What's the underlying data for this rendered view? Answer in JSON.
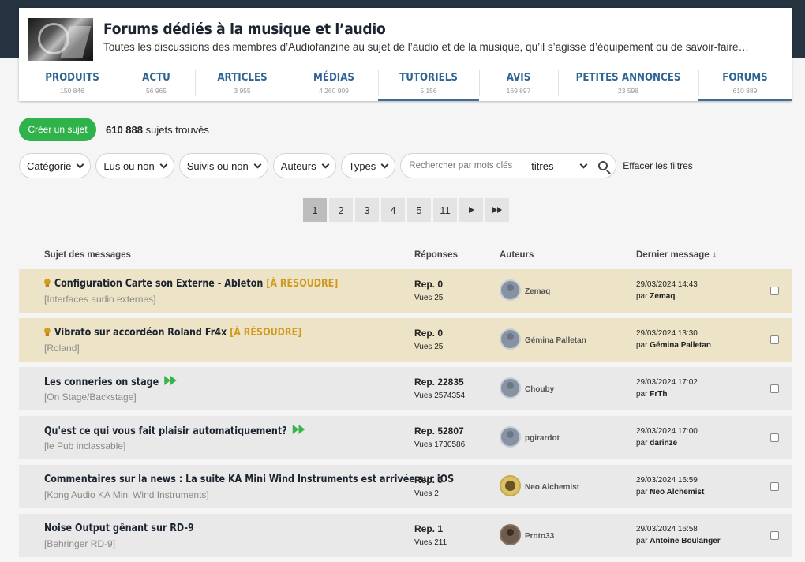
{
  "header": {
    "title": "Forums dédiés à la musique et l’audio",
    "subtitle": "Toutes les discussions des membres d’Audiofanzine au sujet de l’audio et de la musique, qu’il s’agisse d’équipement ou de savoir-faire…"
  },
  "nav": [
    {
      "label": "PRODUITS",
      "count": "150 846"
    },
    {
      "label": "ACTU",
      "count": "56 965"
    },
    {
      "label": "ARTICLES",
      "count": "3 955"
    },
    {
      "label": "MÉDIAS",
      "count": "4 260 909"
    },
    {
      "label": "TUTORIELS",
      "count": "5 156"
    },
    {
      "label": "AVIS",
      "count": "169 897"
    },
    {
      "label": "PETITES ANNONCES",
      "count": "23 598"
    },
    {
      "label": "FORUMS",
      "count": "610 889"
    }
  ],
  "toolbar": {
    "create_label": "Créer un sujet",
    "found_count": "610 888",
    "found_suffix": " sujets trouvés"
  },
  "filters": {
    "category": "Catégorie",
    "read": "Lus ou non",
    "followed": "Suivis ou non",
    "authors": "Auteurs",
    "types": "Types",
    "search_placeholder": "Rechercher par mots clés",
    "search_scope": "titres",
    "clear": "Effacer les filtres"
  },
  "pagination": [
    "1",
    "2",
    "3",
    "4",
    "5",
    "11"
  ],
  "columns": {
    "subject": "Sujet des messages",
    "replies": "Réponses",
    "authors": "Auteurs",
    "last": "Dernier message"
  },
  "rows": [
    {
      "title": "Configuration Carte son Externe - Ableton",
      "tag": "[À RÉSOUDRE]",
      "category": "[Interfaces audio externes]",
      "replies": "Rep. 0",
      "views": "Vues 25",
      "author": "Zemaq",
      "date": "29/03/2024 14:43",
      "by_prefix": "par ",
      "by": "Zemaq"
    },
    {
      "title": "Vibrato sur accordéon Roland Fr4x",
      "tag": "[À RÉSOUDRE]",
      "category": "[Roland]",
      "replies": "Rep. 0",
      "views": "Vues 25",
      "author": "Gémina Palletan",
      "date": "29/03/2024 13:30",
      "by_prefix": "par ",
      "by": "Gémina Palletan"
    },
    {
      "title": "Les conneries on stage",
      "category": "[On Stage/Backstage]",
      "replies": "Rep. 22835",
      "views": "Vues 2574354",
      "author": "Chouby",
      "date": "29/03/2024 17:02",
      "by_prefix": "par ",
      "by": "FrTh"
    },
    {
      "title": "Qu'est ce qui vous fait plaisir automatiquement?",
      "category": "[le Pub inclassable]",
      "replies": "Rep. 52807",
      "views": "Vues 1730586",
      "author": "pgirardot",
      "date": "29/03/2024 17:00",
      "by_prefix": "par ",
      "by": "darinze"
    },
    {
      "title": "Commentaires sur la news : La suite KA Mini Wind Instruments est arrivée sur iOS",
      "category": "[Kong Audio KA Mini Wind Instruments]",
      "replies": "Rep. 0",
      "views": "Vues 2",
      "author": "Neo Alchemist",
      "date": "29/03/2024 16:59",
      "by_prefix": "par ",
      "by": "Neo Alchemist"
    },
    {
      "title": "Noise Output gênant sur RD-9",
      "category": "[Behringer RD-9]",
      "replies": "Rep. 1",
      "views": "Vues 211",
      "author": "Proto33",
      "date": "29/03/2024 16:58",
      "by_prefix": "par ",
      "by": "Antoine Boulanger"
    }
  ]
}
